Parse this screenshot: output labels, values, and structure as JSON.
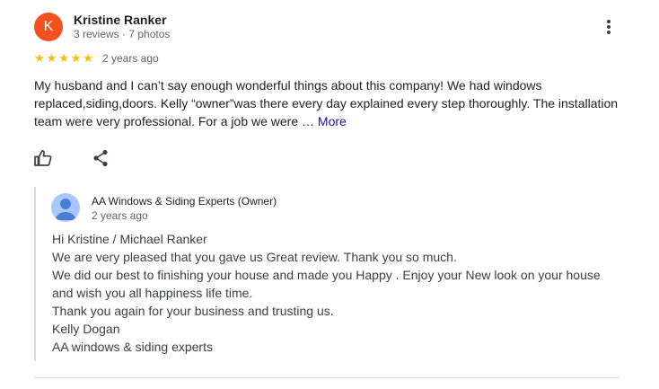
{
  "review": {
    "avatar_letter": "K",
    "avatar_color": "#f4511e",
    "reviewer_name": "Kristine Ranker",
    "reviewer_meta": "3 reviews · 7 photos",
    "rating": 5,
    "rating_max": 5,
    "star_glyph": "★",
    "date": "2 years ago",
    "text": "My husband and I can’t say enough wonderful things about this company! We had windows replaced,siding,doors. Kelly “owner”was there every day explained every step thoroughly. The installation team were very professional. For a job we were … ",
    "more_label": "More",
    "actions": {
      "like_icon": "thumbs-up-icon",
      "share_icon": "share-icon",
      "menu_icon": "more-vert-icon"
    }
  },
  "owner_response": {
    "owner_name": "AA Windows & Siding Experts (Owner)",
    "date": "2 years ago",
    "avatar_icon": "person-icon",
    "lines": [
      "Hi Kristine / Michael Ranker",
      "We are very pleased that you gave us Great review. Thank you so much.",
      "We did our best to finishing your house and made you Happy . Enjoy your New look on your house and wish you all happiness life time.",
      "Thank you again for your business and trusting us.",
      "Kelly Dogan",
      "AA windows & siding experts"
    ]
  },
  "colors": {
    "star": "#fbbc04",
    "link": "#1a0dab",
    "owner_avatar_bg": "#a8c7fa",
    "owner_avatar_fg": "#4a7fd6"
  }
}
